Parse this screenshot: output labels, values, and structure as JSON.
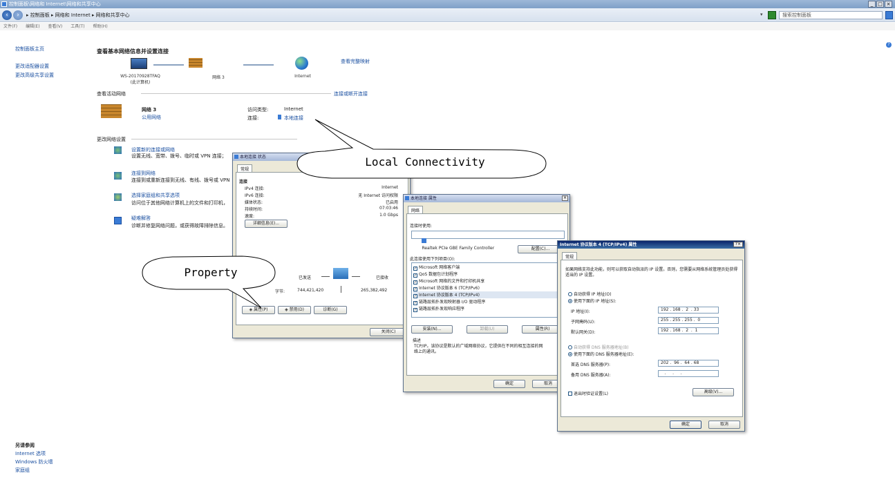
{
  "window": {
    "title": "控制面板\\网络和 Internet\\网络和共享中心",
    "controls": [
      "_",
      "□",
      "×"
    ]
  },
  "address": {
    "breadcrumb": "▸ 控制面板 ▸ 网络和 Internet ▸ 网络和共享中心",
    "search_placeholder": "搜索控制面板"
  },
  "menu": [
    "文件(F)",
    "编辑(E)",
    "查看(V)",
    "工具(T)",
    "帮助(H)"
  ],
  "leftnav": {
    "home": "控制面板主页",
    "items": [
      "更改适配器设置",
      "更改高级共享设置"
    ]
  },
  "seealso": {
    "title": "另请参阅",
    "items": [
      "Internet 选项",
      "Windows 防火墙",
      "家庭组"
    ]
  },
  "main": {
    "title": "查看基本网络信息并设置连接",
    "full_map": "查看完整映射",
    "computer_name": "WS-20170928TFAQ",
    "computer_sub": "(此计算机)",
    "network_name": "网络  3",
    "internet_name": "Internet",
    "active_section": "查看活动网络",
    "connect_link": "连接或断开连接",
    "active_network": {
      "name": "网络  3",
      "type": "公用网络",
      "access_label": "访问类型:",
      "access_value": "Internet",
      "conn_label": "连接:",
      "conn_value": "本地连接"
    },
    "change_section": "更改网络设置",
    "tasks": [
      {
        "title": "设置新的连接或网络",
        "desc": "设置无线、宽带、拨号、临时或 VPN 连接；"
      },
      {
        "title": "连接到网络",
        "desc": "连接到或重新连接到无线、有线、拨号或 VPN"
      },
      {
        "title": "选择家庭组和共享选项",
        "desc": "访问位于其他网络计算机上的文件和打印机，"
      },
      {
        "title": "疑难解答",
        "desc": "诊断并修复网络问题，或获得故障排除信息。"
      }
    ]
  },
  "status_dialog": {
    "title": "本地连接 状态",
    "tab": "常规",
    "group": "连接",
    "rows": [
      {
        "label": "IPv4 连接:",
        "value": "Internet"
      },
      {
        "label": "IPv6 连接:",
        "value": "无 Internet 访问权限"
      },
      {
        "label": "媒体状态:",
        "value": "已启用"
      },
      {
        "label": "持续时间:",
        "value": "07:03:46"
      },
      {
        "label": "速度:",
        "value": "1.0 Gbps"
      }
    ],
    "details_btn": "详细信息(E)...",
    "sent_label": "已发送",
    "recv_label": "已接收",
    "bytes_label": "字节:",
    "sent_bytes": "744,421,420",
    "recv_bytes": "265,382,492",
    "btn_props": "属性(P)",
    "btn_disable": "禁用(D)",
    "btn_diag": "诊断(G)",
    "btn_close": "关闭(C)"
  },
  "props_dialog": {
    "title": "本地连接 属性",
    "tab": "网络",
    "connect_using": "连接时使用:",
    "adapter": "Realtek PCIe GBE Family Controller",
    "configure_btn": "配置(C)...",
    "items_label": "此连接使用下列项目(O):",
    "items": [
      "Microsoft 网络客户端",
      "QoS 数据包计划程序",
      "Microsoft 网络的文件和打印机共享",
      "Internet 协议版本 6 (TCP/IPv6)",
      "Internet 协议版本 4 (TCP/IPv4)",
      "链路层拓扑发现映射器 I/O 驱动程序",
      "链路层拓扑发现响应程序"
    ],
    "install_btn": "安装(N)...",
    "uninstall_btn": "卸载(U)",
    "properties_btn": "属性(R)",
    "desc_label": "描述",
    "desc_text": "TCP/IP。该协议是默认的广域网络协议，它提供在不同的相互连接的网络上的通讯。",
    "ok_btn": "确定",
    "cancel_btn": "取消"
  },
  "ipv4_dialog": {
    "title": "Internet 协议版本 4 (TCP/IPv4) 属性",
    "title_btns": "?×",
    "tab": "常规",
    "intro": "如果网络支持此功能，则可以获取自动指派的 IP 设置。否则，您需要从网络系统管理员处获得适当的 IP 设置。",
    "auto_ip": "自动获得 IP 地址(O)",
    "manual_ip": "使用下面的 IP 地址(S):",
    "ip_label": "IP 地址(I):",
    "ip_value": "192 . 168 .  2  . 33",
    "mask_label": "子网掩码(U):",
    "mask_value": "255 . 255 . 255 .  0",
    "gw_label": "默认网关(D):",
    "gw_value": "192 . 168 .  2  .  1",
    "auto_dns": "自动获得 DNS 服务器地址(B)",
    "manual_dns": "使用下面的 DNS 服务器地址(E):",
    "dns1_label": "首选 DNS 服务器(P):",
    "dns1_value": "202 .  96 .  64 . 68",
    "dns2_label": "备用 DNS 服务器(A):",
    "dns2_value": "   .     .     .   ",
    "validate": "退出时验证设置(L)",
    "advanced_btn": "高级(V)...",
    "ok_btn": "确定",
    "cancel_btn": "取消"
  },
  "callouts": {
    "local": "Local Connectivity",
    "property": "Property"
  }
}
